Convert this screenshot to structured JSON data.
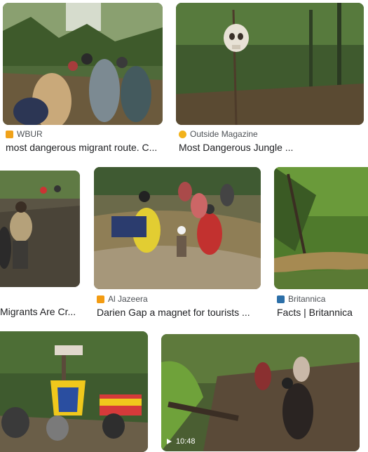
{
  "results": [
    {
      "source": "WBUR",
      "title": "most dangerous migrant route. C...",
      "favicon_color": "#f0a21a"
    },
    {
      "source": "Outside Magazine",
      "title": "Most Dangerous Jungle ...",
      "favicon_color": "#f2b21b"
    },
    {
      "source": "",
      "title": "Migrants Are Cr...",
      "favicon_color": ""
    },
    {
      "source": "Al Jazeera",
      "title": "Darien Gap a magnet for tourists ...",
      "favicon_color": "#f39c12"
    },
    {
      "source": "Britannica",
      "title": "Facts | Britannica",
      "favicon_color": "#2c6fa8"
    },
    {
      "source": "",
      "title": "",
      "favicon_color": ""
    },
    {
      "source": "",
      "title": "",
      "favicon_color": "",
      "duration": "10:48"
    }
  ]
}
